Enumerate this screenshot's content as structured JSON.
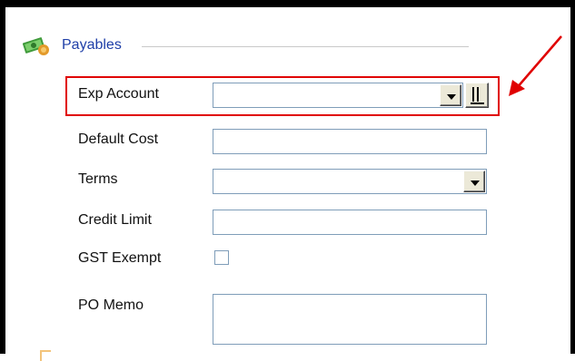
{
  "section": {
    "title": "Payables",
    "icon": "money-icon"
  },
  "fields": {
    "exp_account": {
      "label": "Exp Account",
      "value": ""
    },
    "default_cost": {
      "label": "Default Cost",
      "value": ""
    },
    "terms": {
      "label": "Terms",
      "value": ""
    },
    "credit_limit": {
      "label": "Credit Limit",
      "value": ""
    },
    "gst_exempt": {
      "label": "GST Exempt",
      "checked": false
    },
    "po_memo": {
      "label": "PO Memo",
      "value": ""
    }
  },
  "annotation": {
    "highlight_color": "#e00000",
    "arrow_color": "#e00000"
  }
}
